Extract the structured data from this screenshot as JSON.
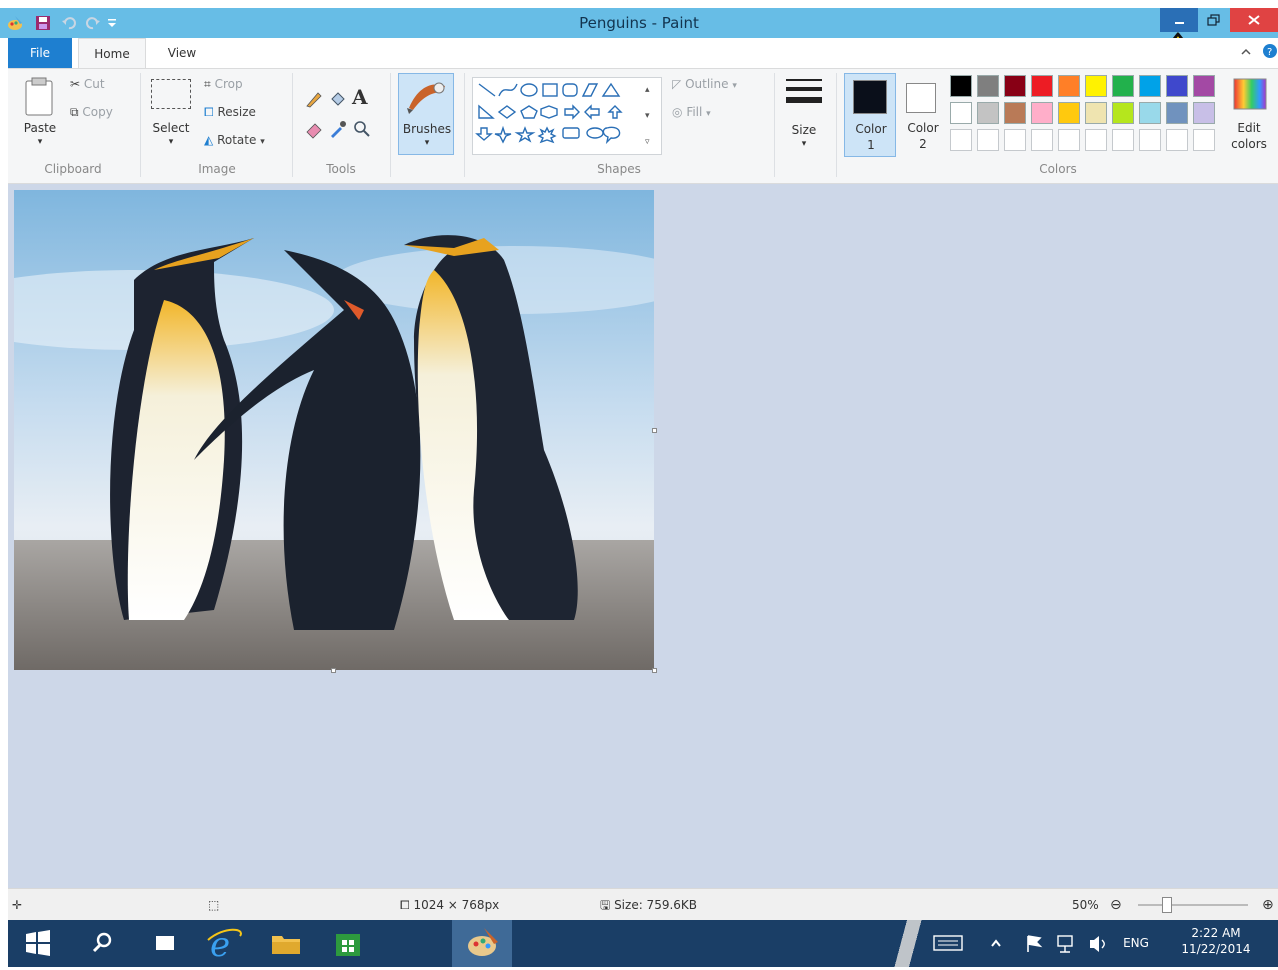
{
  "window": {
    "title": "Penguins - Paint"
  },
  "tabs": [
    {
      "label": "File"
    },
    {
      "label": "Home"
    },
    {
      "label": "View"
    }
  ],
  "clipboard": {
    "paste": "Paste",
    "cut": "Cut",
    "copy": "Copy",
    "group": "Clipboard"
  },
  "image": {
    "select": "Select",
    "crop": "Crop",
    "resize": "Resize",
    "rotate": "Rotate",
    "group": "Image"
  },
  "tools": {
    "text_glyph": "A",
    "group": "Tools"
  },
  "brushes": {
    "label": "Brushes"
  },
  "shapes": {
    "outline": "Outline",
    "fill": "Fill",
    "group": "Shapes"
  },
  "size": {
    "label": "Size"
  },
  "colors": {
    "color1_label": "Color",
    "color1_num": "1",
    "color2_label": "Color",
    "color2_num": "2",
    "edit_label": "Edit",
    "edit_label2": "colors",
    "group": "Colors",
    "color1": "#0a0f1a",
    "color2": "#ffffff",
    "row1": [
      "#000000",
      "#7f7f7f",
      "#880015",
      "#ed1c24",
      "#ff7f27",
      "#fff200",
      "#22b14c",
      "#00a2e8",
      "#3f48cc",
      "#a349a4"
    ],
    "row2": [
      "#ffffff",
      "#c3c3c3",
      "#b97a57",
      "#ffaec9",
      "#ffc90e",
      "#efe4b0",
      "#b5e61d",
      "#99d9ea",
      "#7092be",
      "#c8bfe7"
    ]
  },
  "status": {
    "image_size": "1024 × 768px",
    "file_size": "Size: 759.6KB",
    "zoom": "50%"
  },
  "taskbar": {
    "lang": "ENG",
    "time": "2:22 AM",
    "date": "11/22/2014"
  }
}
